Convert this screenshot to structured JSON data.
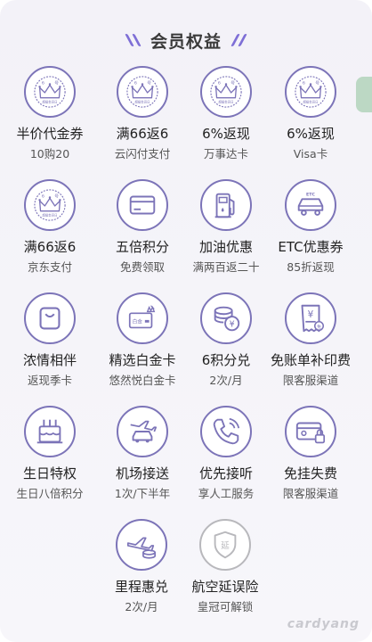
{
  "header": {
    "title": "会员权益"
  },
  "colors": {
    "accent": "#7c74b8",
    "slash": "#7e6fd6",
    "disabled": "#b8b8bc"
  },
  "benefits": [
    {
      "title": "半价代金券",
      "sub": "10购20",
      "icon": "crown-badge-icon",
      "badge": [
        "6",
        "号",
        "超级会员日"
      ]
    },
    {
      "title": "满66返6",
      "sub": "云闪付支付",
      "icon": "crown-badge-icon",
      "badge": [
        "6",
        "号",
        "超级会员日"
      ]
    },
    {
      "title": "6%返现",
      "sub": "万事达卡",
      "icon": "crown-badge-icon",
      "badge": [
        "6",
        "号",
        "超级会员日"
      ]
    },
    {
      "title": "6%返现",
      "sub": "Visa卡",
      "icon": "crown-badge-icon",
      "badge": [
        "6",
        "号",
        "超级会员日"
      ]
    },
    {
      "title": "满66返6",
      "sub": "京东支付",
      "icon": "crown-badge-icon",
      "badge": [
        "6",
        "号",
        "超级会员日"
      ]
    },
    {
      "title": "五倍积分",
      "sub": "免费领取",
      "icon": "credit-card-icon"
    },
    {
      "title": "加油优惠",
      "sub": "满两百返二十",
      "icon": "fuel-pump-icon"
    },
    {
      "title": "ETC优惠券",
      "sub": "85折返现",
      "icon": "etc-car-icon",
      "badge": [
        "ETC"
      ]
    },
    {
      "title": "浓情相伴",
      "sub": "返现季卡",
      "icon": "shopping-bag-icon"
    },
    {
      "title": "精选白金卡",
      "sub": "悠然悦白金卡",
      "icon": "platinum-card-icon",
      "badge": [
        "白金"
      ]
    },
    {
      "title": "6积分兑",
      "sub": "2次/月",
      "icon": "coins-icon"
    },
    {
      "title": "免账单补印费",
      "sub": "限客服渠道",
      "icon": "bill-icon"
    },
    {
      "title": "生日特权",
      "sub": "生日八倍积分",
      "icon": "birthday-cake-icon"
    },
    {
      "title": "机场接送",
      "sub": "1次/下半年",
      "icon": "airport-car-icon"
    },
    {
      "title": "优先接听",
      "sub": "享人工服务",
      "icon": "phone-icon"
    },
    {
      "title": "免挂失费",
      "sub": "限客服渠道",
      "icon": "card-lock-icon"
    },
    {
      "title": "里程惠兑",
      "sub": "2次/月",
      "icon": "plane-coins-icon"
    },
    {
      "title": "航空延误险",
      "sub": "皇冠可解锁",
      "icon": "shield-delay-icon",
      "badge": [
        "延"
      ],
      "disabled": true
    }
  ],
  "watermark": "cardyang"
}
